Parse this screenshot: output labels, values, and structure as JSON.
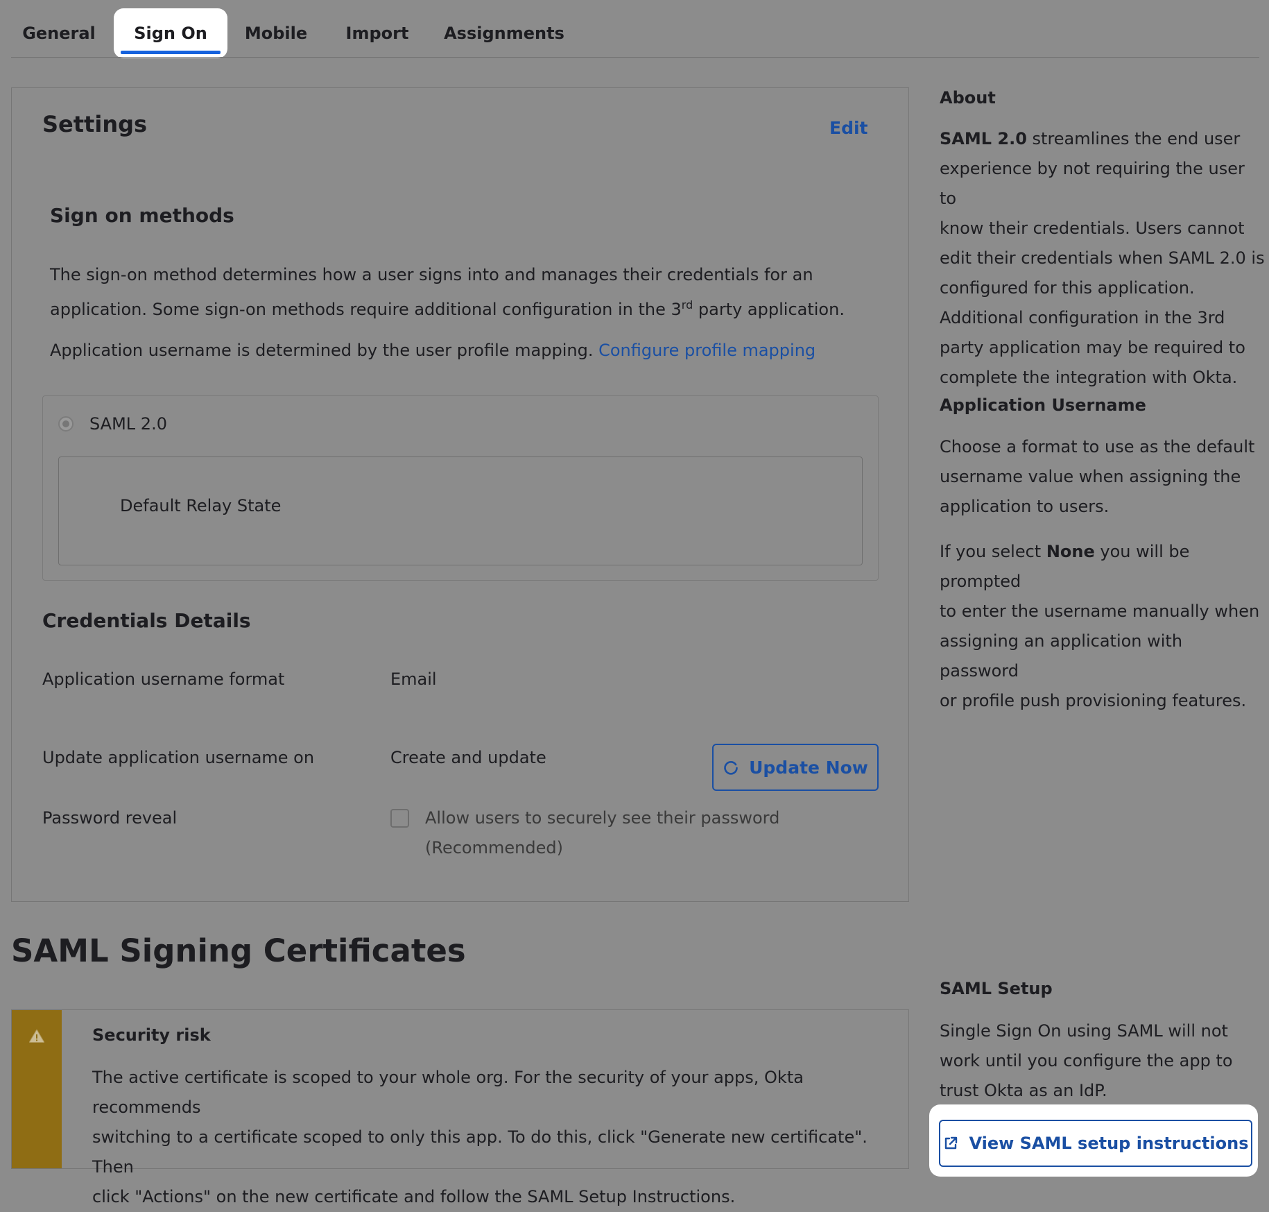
{
  "tabs": {
    "general": "General",
    "sign_on": "Sign On",
    "mobile": "Mobile",
    "import": "Import",
    "assignments": "Assignments"
  },
  "settings": {
    "title": "Settings",
    "edit": "Edit"
  },
  "sign_on_methods": {
    "heading": "Sign on methods",
    "desc_part1": "The sign-on method determines how a user signs into and manages their credentials for an",
    "desc_part2": "application. Some sign-on methods require additional configuration in the 3",
    "desc_sup": "rd",
    "desc_part3": " party application.",
    "username_text": "Application username is determined by the user profile mapping. ",
    "configure_link": "Configure profile mapping",
    "method_label": "SAML 2.0",
    "relay_state_label": "Default Relay State"
  },
  "credentials": {
    "heading": "Credentials Details",
    "format_label": "Application username format",
    "format_value": "Email",
    "update_label": "Update application username on",
    "update_value": "Create and update",
    "update_button": "Update Now",
    "reveal_label": "Password reveal",
    "reveal_checkbox_line1": "Allow users to securely see their password",
    "reveal_checkbox_line2": "(Recommended)",
    "reveal_checked": false
  },
  "certificates": {
    "heading": "SAML Signing Certificates",
    "alert_title": "Security risk",
    "alert_line1": "The active certificate is scoped to your whole org. For the security of your apps, Okta recommends",
    "alert_line2": "switching to a certificate scoped to only this app. To do this, click \"Generate new certificate\". Then",
    "alert_line3": "click \"Actions\" on the new certificate and follow the SAML Setup Instructions."
  },
  "sidebar": {
    "about_heading": "About",
    "about_bold": "SAML 2.0",
    "about_lines": [
      " streamlines the end user",
      "experience by not requiring the user to",
      "know their credentials. Users cannot",
      "edit their credentials when SAML 2.0 is",
      "configured for this application.",
      "Additional configuration in the 3rd",
      "party application may be required to",
      "complete the integration with Okta."
    ],
    "app_username_heading": "Application Username",
    "app_username_lines": [
      "Choose a format to use as the default",
      "username value when assigning the",
      "application to users."
    ],
    "none_prefix": "If you select ",
    "none_bold": "None",
    "none_lines": [
      " you will be prompted",
      "to enter the username manually when",
      "assigning an application with password",
      "or profile push provisioning features."
    ],
    "saml_setup_heading": "SAML Setup",
    "saml_setup_lines": [
      "Single Sign On using SAML will not",
      "work until you configure the app to",
      "trust Okta as an IdP."
    ],
    "saml_button": "View SAML setup instructions"
  },
  "colors": {
    "background": "#8c8c8c",
    "link": "#1a4fa3",
    "tab_underline": "#1662dd",
    "alert_stripe": "#8f6d14"
  }
}
